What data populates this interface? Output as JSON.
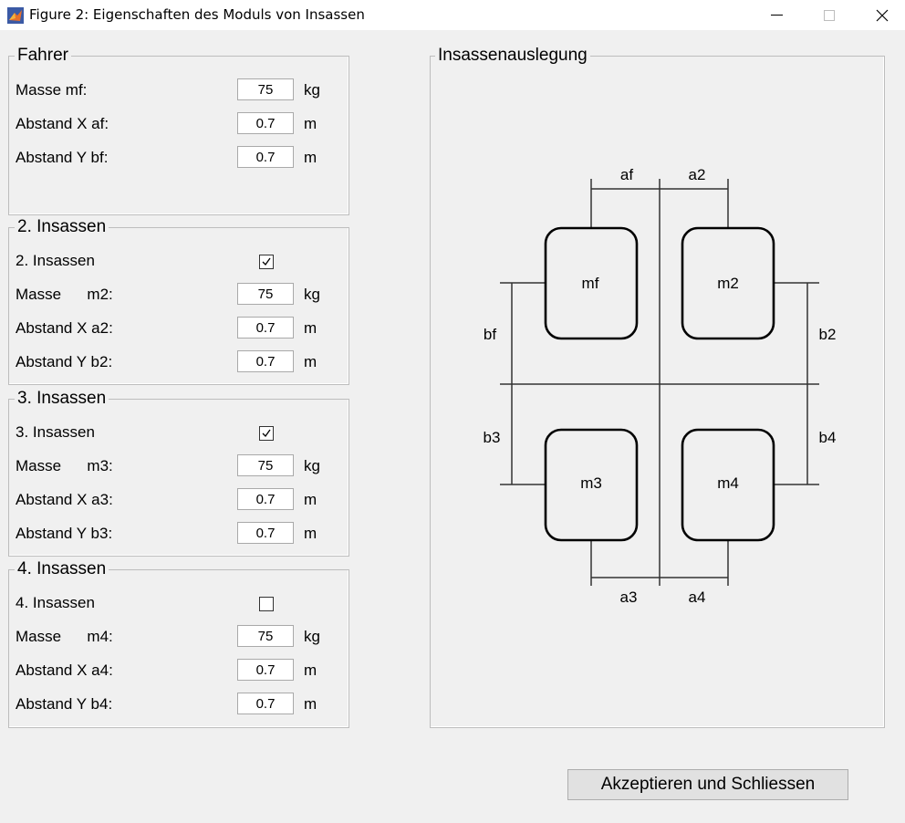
{
  "window": {
    "title": "Figure 2: Eigenschaften des Moduls von Insassen",
    "icon": "matlab-icon",
    "controls": [
      "minimize-icon",
      "maximize-icon",
      "close-icon"
    ]
  },
  "fahrer": {
    "title": "Fahrer",
    "mass_label": "Masse mf:",
    "mass_value": "75",
    "mass_unit": "kg",
    "dx_label": "Abstand X af:",
    "dx_value": "0.7",
    "dx_unit": "m",
    "dy_label": "Abstand Y bf:",
    "dy_value": "0.7",
    "dy_unit": "m"
  },
  "occupants": [
    {
      "title": "2. Insassen",
      "enable_label": "2. Insassen",
      "enabled": true,
      "mass_label": "Masse      m2:",
      "mass_value": "75",
      "mass_unit": "kg",
      "dx_label": "Abstand X a2:",
      "dx_value": "0.7",
      "dx_unit": "m",
      "dy_label": "Abstand Y b2:",
      "dy_value": "0.7",
      "dy_unit": "m"
    },
    {
      "title": "3. Insassen",
      "enable_label": "3. Insassen",
      "enabled": true,
      "mass_label": "Masse      m3:",
      "mass_value": "75",
      "mass_unit": "kg",
      "dx_label": "Abstand X a3:",
      "dx_value": "0.7",
      "dx_unit": "m",
      "dy_label": "Abstand Y b3:",
      "dy_value": "0.7",
      "dy_unit": "m"
    },
    {
      "title": "4. Insassen",
      "enable_label": "4. Insassen",
      "enabled": false,
      "mass_label": "Masse      m4:",
      "mass_value": "75",
      "mass_unit": "kg",
      "dx_label": "Abstand X a4:",
      "dx_value": "0.7",
      "dx_unit": "m",
      "dy_label": "Abstand Y b4:",
      "dy_value": "0.7",
      "dy_unit": "m"
    }
  ],
  "layout_panel": {
    "title": "Insassenauslegung",
    "seats": [
      "mf",
      "m2",
      "m3",
      "m4"
    ],
    "dims": {
      "af": "af",
      "a2": "a2",
      "a3": "a3",
      "a4": "a4",
      "bf": "bf",
      "b2": "b2",
      "b3": "b3",
      "b4": "b4"
    }
  },
  "accept_button": "Akzeptieren und Schliessen"
}
